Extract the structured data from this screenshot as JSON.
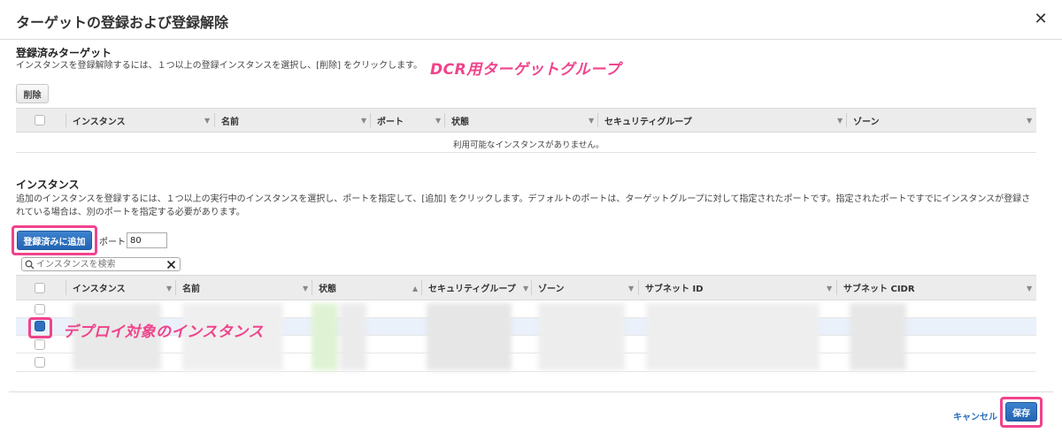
{
  "modal": {
    "title": "ターゲットの登録および登録解除",
    "close_glyph": "✕"
  },
  "registered": {
    "title": "登録済みターゲット",
    "description": "インスタンスを登録解除するには、１つ以上の登録インスタンスを選択し、[削除] をクリックします。",
    "annotation": "DCR用ターゲットグループ",
    "delete_label": "削除",
    "columns": [
      "インスタンス",
      "名前",
      "ポート",
      "状態",
      "セキュリティグループ",
      "ゾーン"
    ],
    "empty_message": "利用可能なインスタンスがありません。"
  },
  "instances": {
    "title": "インスタンス",
    "description_line1": "追加のインスタンスを登録するには、１つ以上の実行中のインスタンスを選択し、ポートを指定して、[追加] をクリックします。デフォルトのポートは、ターゲットグループに対して指定されたポートです。指定されたポートですでにインスタンスが登録さ",
    "description_line2": "れている場合は、別のポートを指定する必要があります。",
    "add_label": "登録済みに追加",
    "port_label": "ポート",
    "port_value": "80",
    "search_placeholder": "インスタンスを検索",
    "annotation": "デプロイ対象のインスタンス",
    "columns": [
      "インスタンス",
      "名前",
      "状態",
      "セキュリティグループ",
      "ゾーン",
      "サブネット ID",
      "サブネット CIDR"
    ]
  },
  "footer": {
    "cancel_label": "キャンセル",
    "save_label": "保存"
  },
  "colors": {
    "accent": "#2465b3",
    "annotation": "#f0438c",
    "selected_row": "#eaf1fb",
    "status_green": "#dff3d4"
  }
}
